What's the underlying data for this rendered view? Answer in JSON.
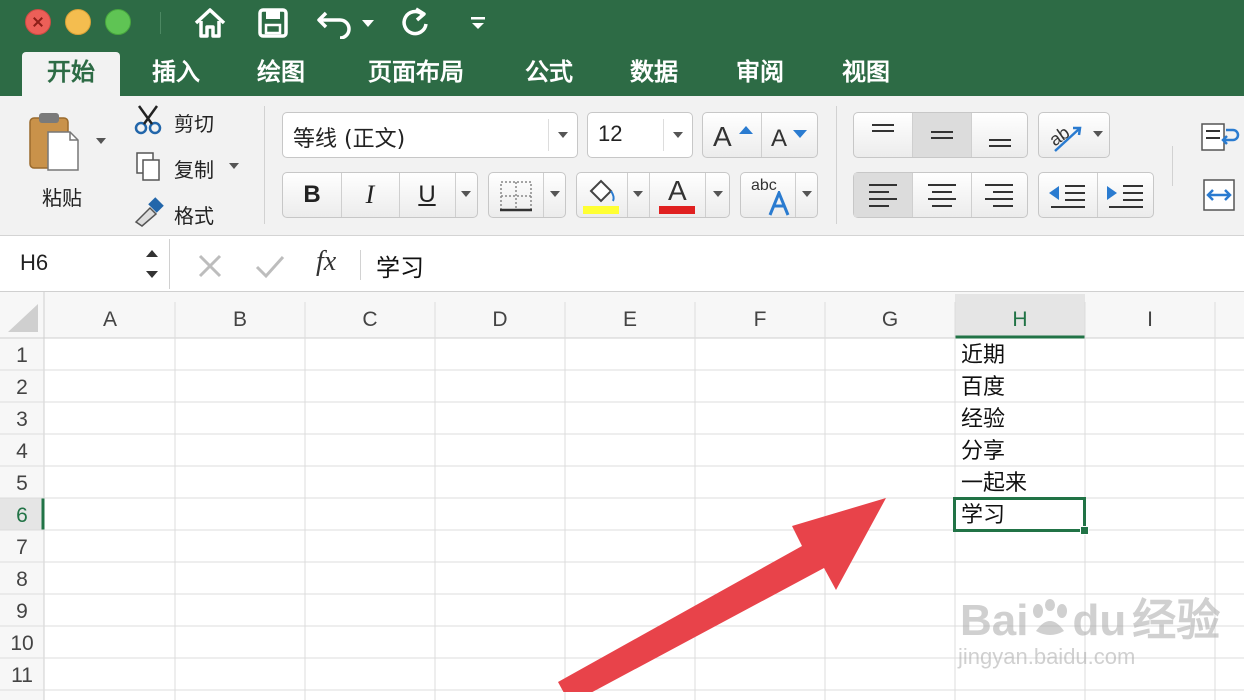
{
  "window": {
    "controls": [
      "close",
      "minimize",
      "maximize"
    ]
  },
  "quick_access": {
    "icons": [
      "home-icon",
      "save-icon",
      "undo-icon",
      "undo-dropdown-icon",
      "redo-icon",
      "customize-toolbar-icon"
    ]
  },
  "tabs": [
    "开始",
    "插入",
    "绘图",
    "页面布局",
    "公式",
    "数据",
    "审阅",
    "视图"
  ],
  "active_tab": "开始",
  "ribbon": {
    "clipboard": {
      "paste": "粘贴",
      "cut": "剪切",
      "copy": "复制",
      "format_painter": "格式"
    },
    "font": {
      "name": "等线 (正文)",
      "size": "12",
      "bold": "B",
      "italic": "I",
      "underline": "U",
      "font_color": "A",
      "spelling": "abc"
    },
    "colors": {
      "fill": "#ffff33",
      "font": "#e02020",
      "accent": "#2d6b45"
    }
  },
  "formula_bar": {
    "name_box": "H6",
    "fx": "fx",
    "content": "学习"
  },
  "sheet": {
    "columns": [
      "A",
      "B",
      "C",
      "D",
      "E",
      "F",
      "G",
      "H",
      "I"
    ],
    "rows": [
      "1",
      "2",
      "3",
      "4",
      "5",
      "6",
      "7",
      "8",
      "9",
      "10",
      "11"
    ],
    "selected_cell": "H6",
    "column_H": [
      "近期",
      "百度",
      "经验",
      "分享",
      "一起来",
      "学习"
    ]
  },
  "watermark": {
    "brand": "Bai",
    "brand2": "du",
    "cn": "经验",
    "url": "jingyan.baidu.com"
  }
}
